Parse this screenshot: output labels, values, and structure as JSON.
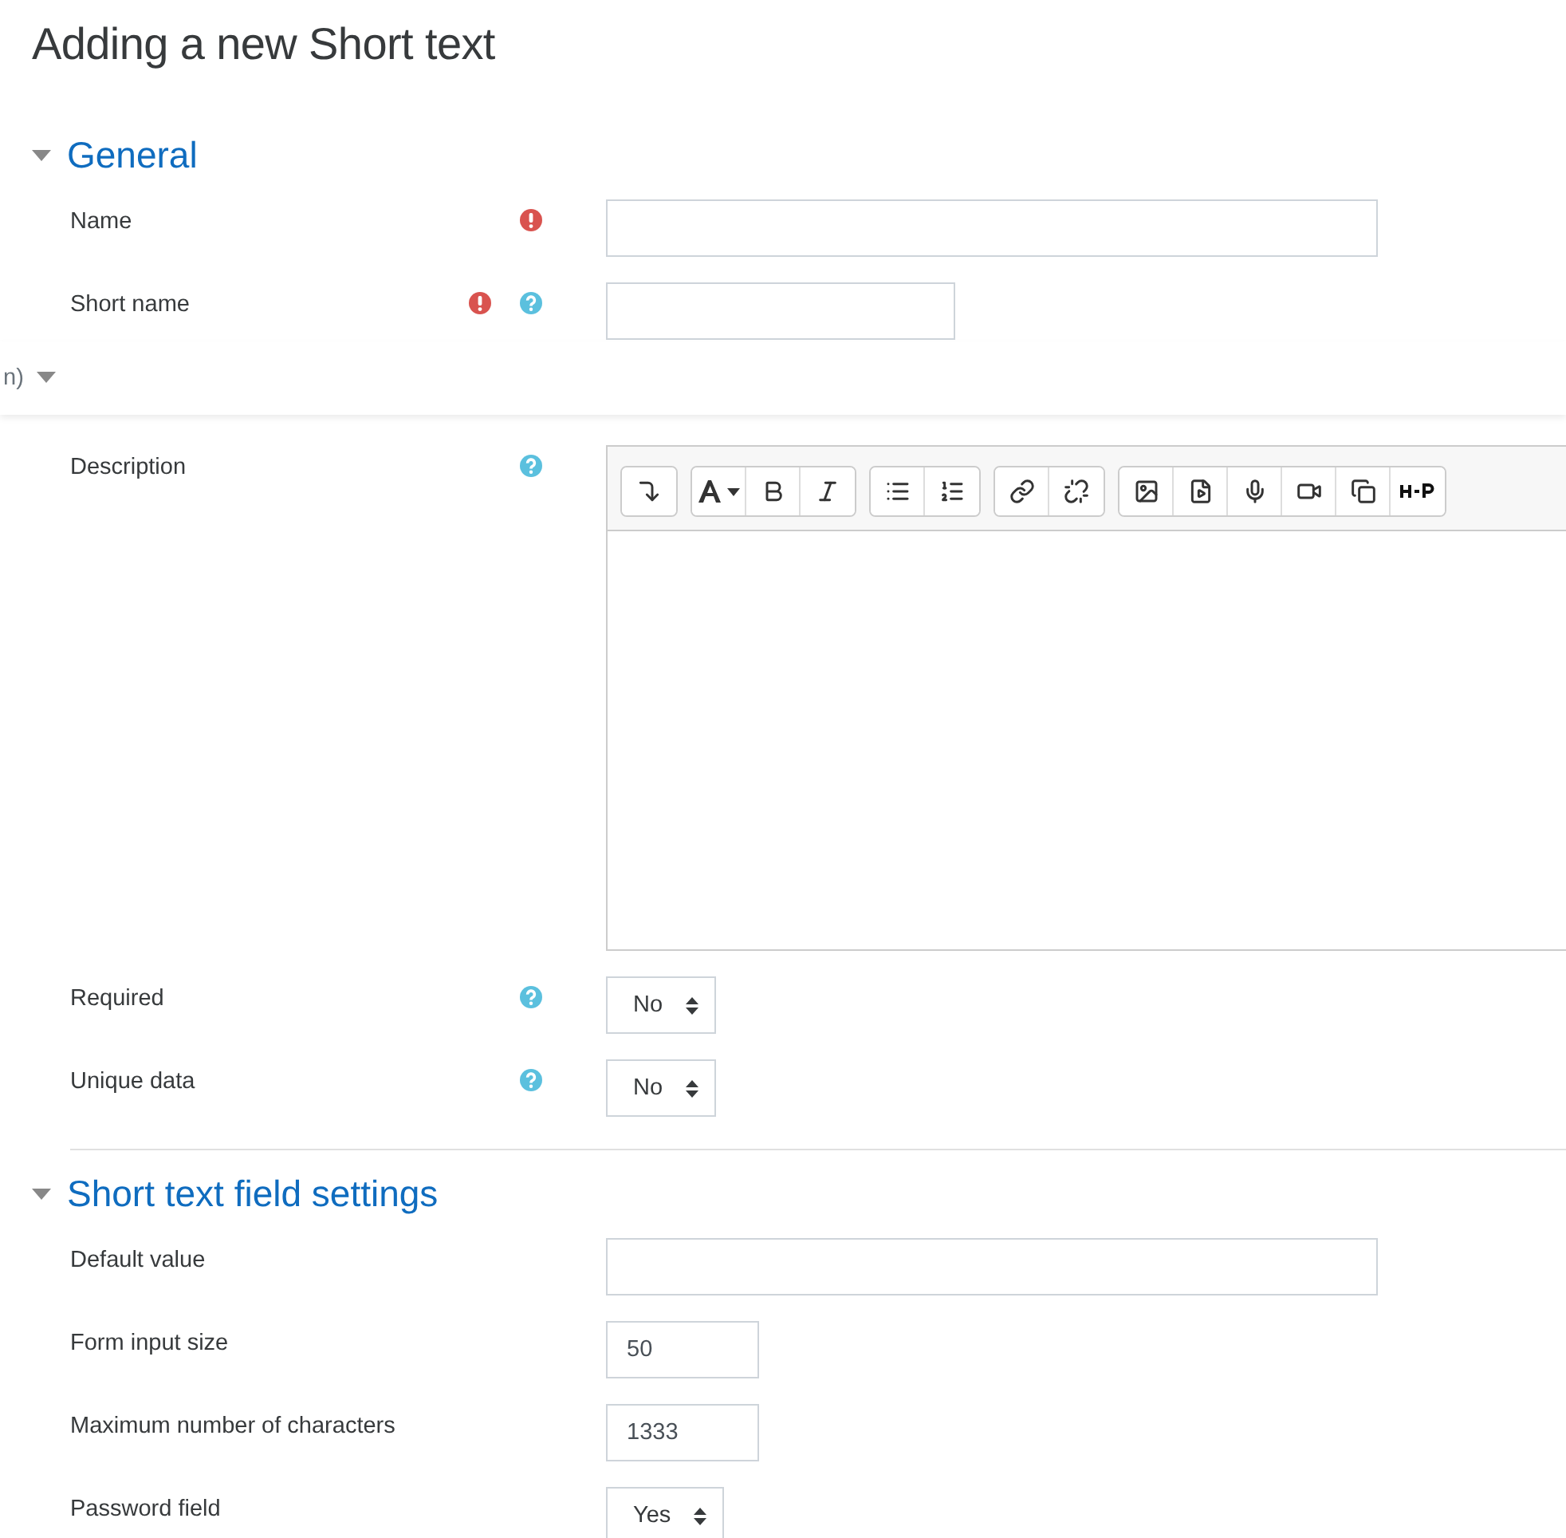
{
  "page_title": "Adding a new Short text",
  "overlay_bar": {
    "text": "n)"
  },
  "sections": [
    {
      "title": "General",
      "expanded": true,
      "fields": [
        {
          "kind": "wide",
          "label": "Name",
          "required": true,
          "help": false
        },
        {
          "kind": "medium",
          "label": "Short name",
          "required": true,
          "help": true
        },
        {
          "kind": "editor",
          "label": "Description",
          "required": false,
          "help": true,
          "toolbar": [
            [
              {
                "kind": "indent"
              }
            ],
            [
              {
                "kind": "font"
              },
              {
                "kind": "bold"
              },
              {
                "kind": "italic"
              }
            ],
            [
              {
                "kind": "bullets"
              },
              {
                "kind": "numbers"
              }
            ],
            [
              {
                "kind": "link"
              },
              {
                "kind": "unlink"
              }
            ],
            [
              {
                "kind": "image"
              },
              {
                "kind": "media"
              },
              {
                "kind": "audio"
              },
              {
                "kind": "video"
              },
              {
                "kind": "copy"
              },
              {
                "kind": "h5p"
              }
            ]
          ]
        },
        {
          "kind": "select",
          "label": "Required",
          "required": false,
          "help": true,
          "value": "No"
        },
        {
          "kind": "select",
          "label": "Unique data",
          "required": false,
          "help": true,
          "value": "No"
        }
      ]
    },
    {
      "title": "Short text field settings",
      "expanded": true,
      "fields": [
        {
          "kind": "wide",
          "label": "Default value",
          "required": false,
          "help": false
        },
        {
          "kind": "short",
          "label": "Form input size",
          "required": false,
          "help": false,
          "value": "50"
        },
        {
          "kind": "short",
          "label": "Maximum number of characters",
          "required": false,
          "help": false,
          "value": "1333"
        },
        {
          "kind": "select",
          "label": "Password field",
          "required": false,
          "help": false,
          "value": "Yes"
        }
      ]
    }
  ]
}
